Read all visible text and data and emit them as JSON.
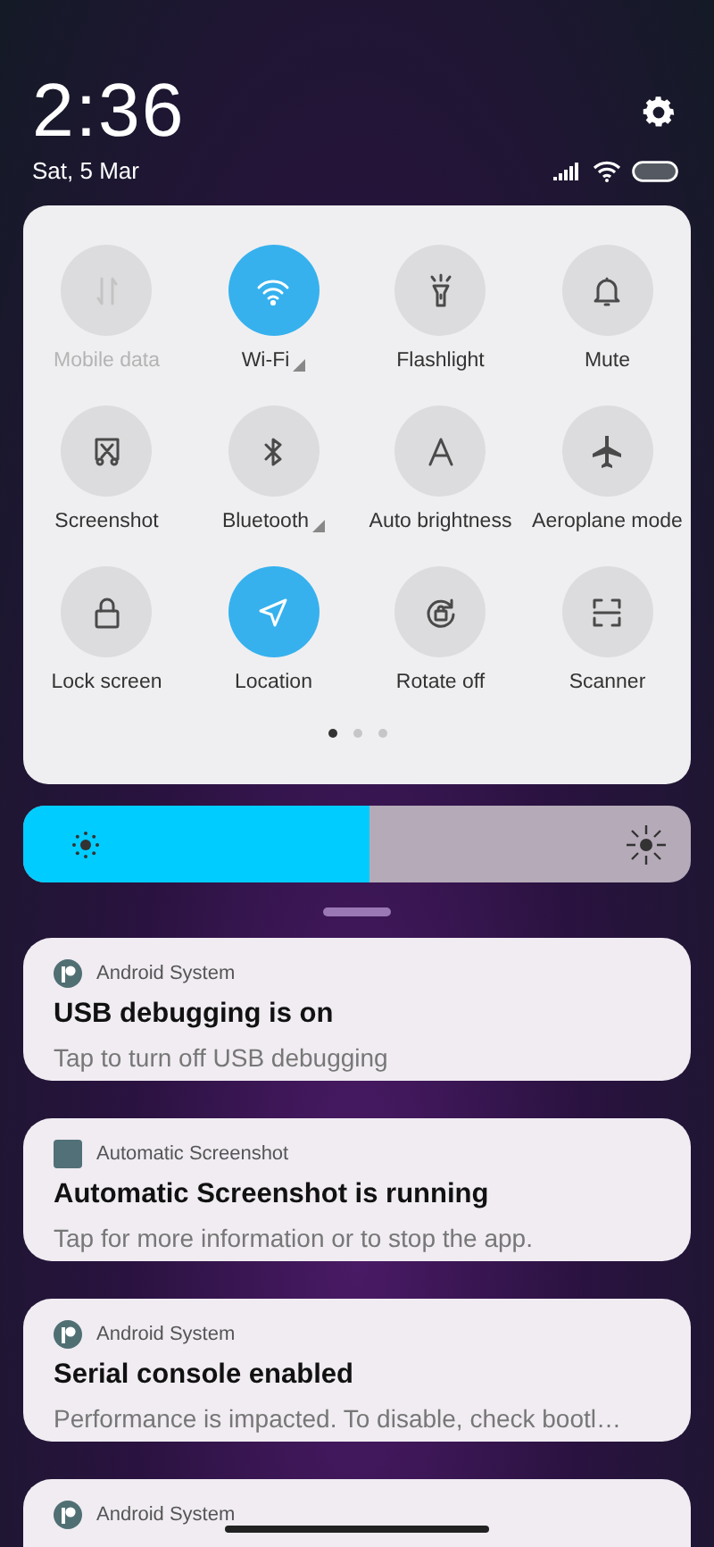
{
  "header": {
    "time": "2:36",
    "date": "Sat, 5 Mar"
  },
  "tiles": [
    {
      "label": "Mobile data",
      "kind": "data",
      "on": false,
      "disabled": true,
      "has_menu": false
    },
    {
      "label": "Wi-Fi",
      "kind": "wifi",
      "on": true,
      "disabled": false,
      "has_menu": true
    },
    {
      "label": "Flashlight",
      "kind": "flashlight",
      "on": false,
      "disabled": false,
      "has_menu": false
    },
    {
      "label": "Mute",
      "kind": "bell",
      "on": false,
      "disabled": false,
      "has_menu": false
    },
    {
      "label": "Screenshot",
      "kind": "screenshot",
      "on": false,
      "disabled": false,
      "has_menu": false
    },
    {
      "label": "Bluetooth",
      "kind": "bluetooth",
      "on": false,
      "disabled": false,
      "has_menu": true
    },
    {
      "label": "Auto brightness",
      "kind": "auto",
      "on": false,
      "disabled": false,
      "has_menu": false
    },
    {
      "label": "Aeroplane mode",
      "kind": "plane",
      "on": false,
      "disabled": false,
      "has_menu": false
    },
    {
      "label": "Lock screen",
      "kind": "lock",
      "on": false,
      "disabled": false,
      "has_menu": false
    },
    {
      "label": "Location",
      "kind": "location",
      "on": true,
      "disabled": false,
      "has_menu": false
    },
    {
      "label": "Rotate off",
      "kind": "rotate",
      "on": false,
      "disabled": false,
      "has_menu": false
    },
    {
      "label": "Scanner",
      "kind": "scanner",
      "on": false,
      "disabled": false,
      "has_menu": false
    }
  ],
  "pages": [
    {
      "selected": true
    },
    {
      "selected": false
    },
    {
      "selected": false
    }
  ],
  "brightness": {
    "level": 0.52
  },
  "notifications": [
    {
      "app": "Android System",
      "kind": "android",
      "title": "USB debugging is on",
      "text": "Tap to turn off USB debugging"
    },
    {
      "app": "Automatic Screenshot",
      "kind": "square",
      "title": "Automatic Screenshot is running",
      "text": "Tap for more information or to stop the app."
    },
    {
      "app": "Android System",
      "kind": "android",
      "title": "Serial console enabled",
      "text": "Performance is impacted. To disable, check bootl…"
    },
    {
      "app": "Android System",
      "kind": "android"
    }
  ]
}
